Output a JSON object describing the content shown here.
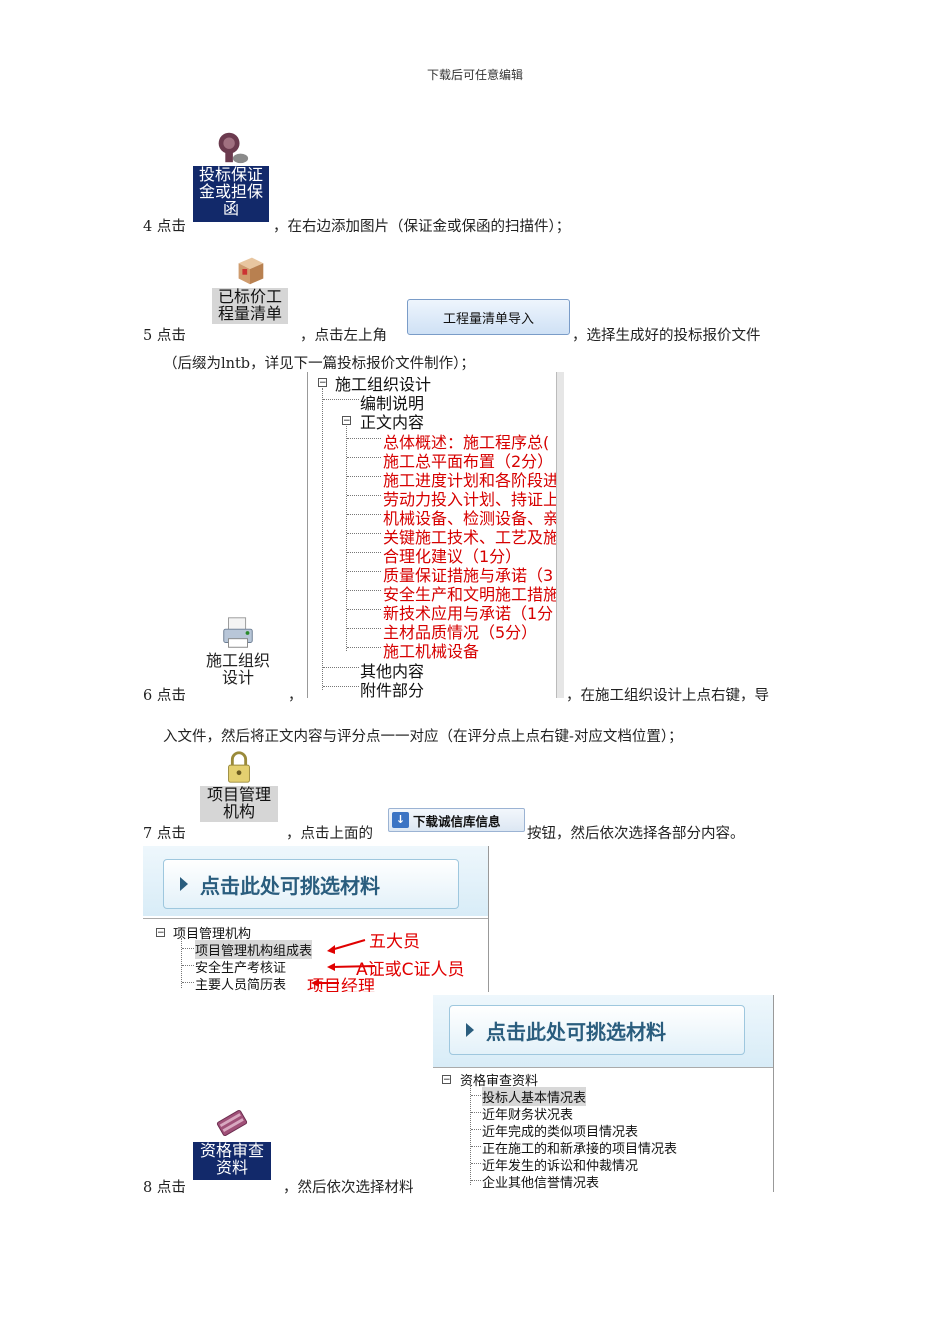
{
  "header": "下载后可任意编辑",
  "step4": {
    "prefix": "4 点击",
    "suffix": "，在右边添加图片（保证金或保函的扫描件）；",
    "tile_label": "投标保证金或担保函"
  },
  "step5": {
    "prefix": "5 点击",
    "middle": "，点击左上角",
    "suffix": "，选择生成好的投标报价文件",
    "line2": "（后缀为lntb，详见下一篇投标报价文件制作）；",
    "tile_label": "已标价工程量清单",
    "import_button": "工程量清单导入"
  },
  "step6": {
    "prefix": "6 点击",
    "comma": "，",
    "suffix": "，在施工组织设计上点右键，导",
    "line2": "入文件，然后将正文内容与评分点一一对应（在评分点上点右键-对应文档位置）；",
    "tile_label": "施工组织设计",
    "tree": {
      "root": "施工组织设计",
      "child1": "编制说明",
      "child2": "正文内容",
      "items": [
        "总体概述：施工程序总(",
        "施工总平面布置（2分）",
        "施工进度计划和各阶段进",
        "劳动力投入计划、持证上",
        "机械设备、检测设备、亲",
        "关键施工技术、工艺及施",
        "合理化建议（1分）",
        "质量保证措施与承诺（3",
        "安全生产和文明施工措施",
        "新技术应用与承诺（1分",
        "主材品质情况（5分）",
        "施工机械设备"
      ],
      "child3": "其他内容",
      "child4": "附件部分"
    }
  },
  "step7": {
    "prefix": "7 点击",
    "middle": "，点击上面的",
    "suffix": "按钮，然后依次选择各部分内容。",
    "tile_label": "项目管理机构",
    "download_button": "下载诚信库信息",
    "banner": "点击此处可挑选材料",
    "tree_root": "项目管理机构",
    "items": [
      "项目管理机构组成表",
      "安全生产考核证",
      "主要人员简历表"
    ],
    "annotations": [
      "五大员",
      "A证或C证人员",
      "项目经理"
    ]
  },
  "step8": {
    "prefix": "8 点击",
    "suffix": "，然后依次选择材料",
    "tile_label": "资格审查资料",
    "banner": "点击此处可挑选材料",
    "tree_root": "资格审查资料",
    "items": [
      "投标人基本情况表",
      "近年财务状况表",
      "近年完成的类似项目情况表",
      "正在施工的和新承接的项目情况表",
      "近年发生的诉讼和仲裁情况",
      "企业其他信誉情况表"
    ]
  }
}
